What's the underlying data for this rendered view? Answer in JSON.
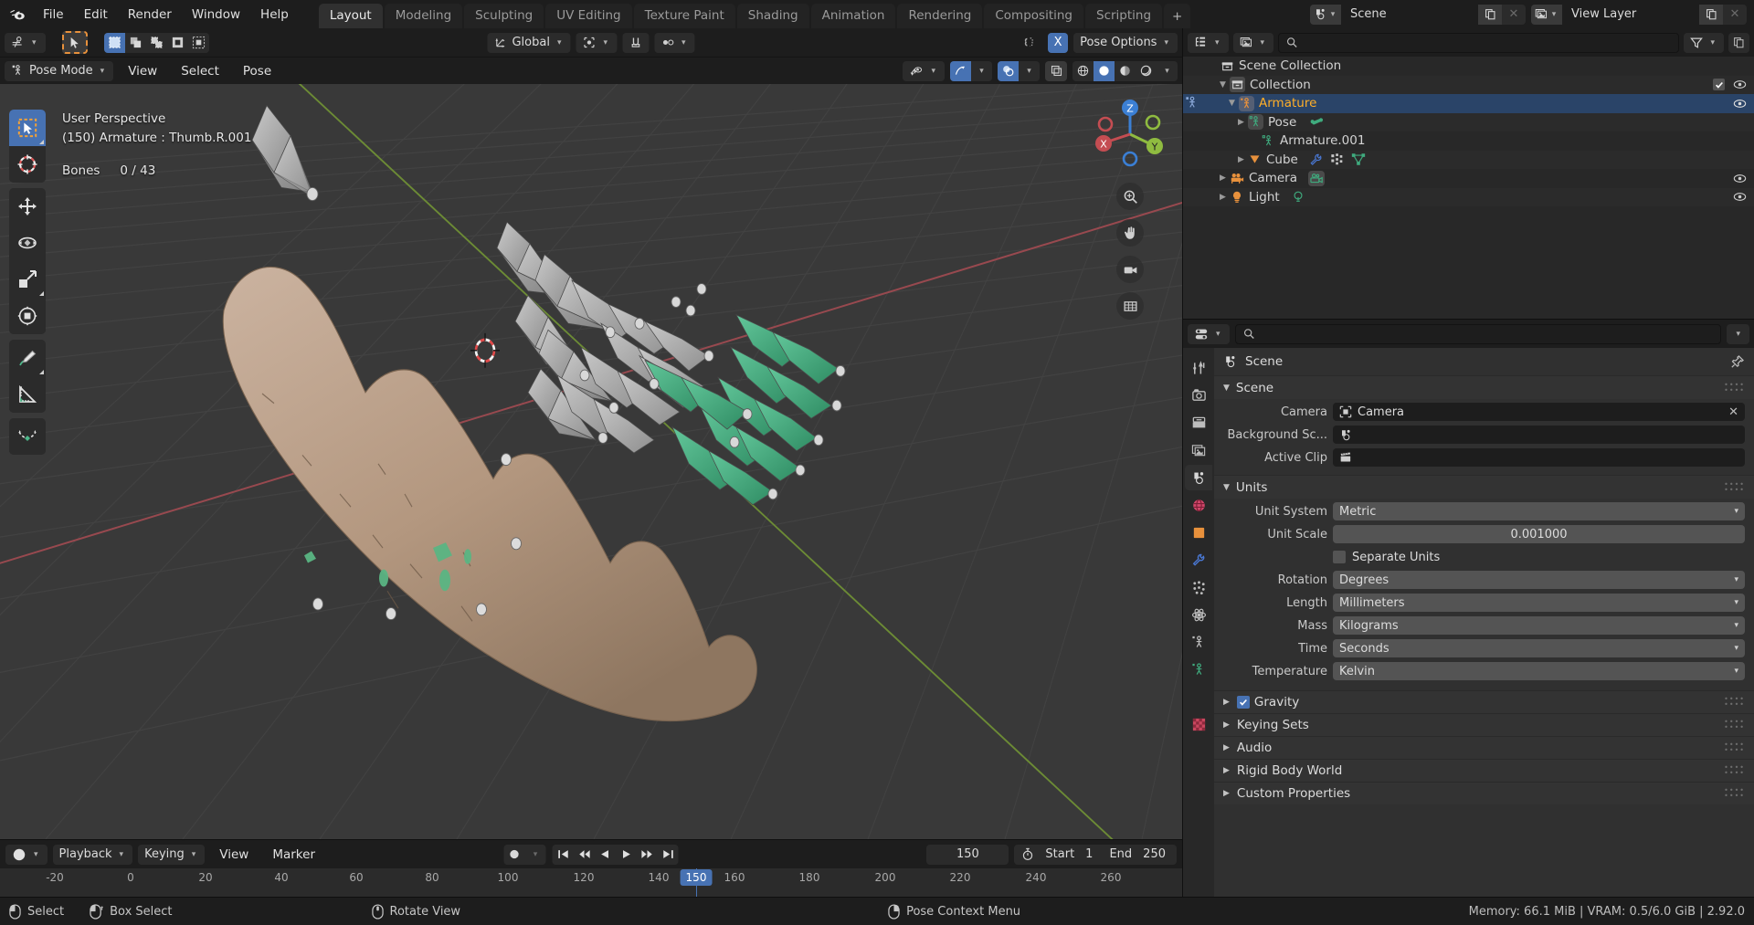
{
  "topbar": {
    "logo_icon": "blender-logo-icon",
    "menus": [
      "File",
      "Edit",
      "Render",
      "Window",
      "Help"
    ],
    "workspace_tabs": [
      {
        "label": "Layout",
        "active": true
      },
      {
        "label": "Modeling",
        "active": false
      },
      {
        "label": "Sculpting",
        "active": false
      },
      {
        "label": "UV Editing",
        "active": false
      },
      {
        "label": "Texture Paint",
        "active": false
      },
      {
        "label": "Shading",
        "active": false
      },
      {
        "label": "Animation",
        "active": false
      },
      {
        "label": "Rendering",
        "active": false
      },
      {
        "label": "Compositing",
        "active": false
      },
      {
        "label": "Scripting",
        "active": false
      }
    ],
    "add_workspace_label": "+",
    "scene_name": "Scene",
    "view_layer_name": "View Layer"
  },
  "viewport": {
    "mode": "Pose Mode",
    "menus": [
      "View",
      "Select",
      "Pose"
    ],
    "transform_orientation": "Global",
    "pose_options": "Pose Options",
    "proportional_x": "X",
    "overlay_text": {
      "perspective": "User Perspective",
      "context": "(150) Armature : Thumb.R.001",
      "bones_label": "Bones",
      "bones_value": "0 / 43"
    },
    "tools": [
      "tweak-select-tool",
      "cursor-tool",
      "move-tool",
      "rotate-tool",
      "scale-tool",
      "transform-tool",
      "annotate-tool",
      "measure-tool",
      "breakdowner-tool"
    ],
    "gizmo_axes": {
      "x": "X",
      "y": "Y",
      "z": "Z"
    },
    "nav_buttons": [
      "zoom-icon",
      "pan-hand-icon",
      "camera-view-icon",
      "toggle-ortho-icon"
    ]
  },
  "timeline": {
    "editor_icon": "timeline-editor-icon",
    "menus": [
      "Playback",
      "Keying",
      "View",
      "Marker"
    ],
    "record_icon": "auto-keying-icon",
    "transport": [
      "jump-start-icon",
      "prev-keyframe-icon",
      "play-reverse-icon",
      "play-icon",
      "next-keyframe-icon",
      "jump-end-icon"
    ],
    "current_frame": "150",
    "start_label": "Start",
    "start_value": "1",
    "end_label": "End",
    "end_value": "250",
    "ruler_ticks": [
      "-20",
      "0",
      "20",
      "40",
      "60",
      "80",
      "100",
      "120",
      "140",
      "160",
      "180",
      "200",
      "220",
      "240",
      "260"
    ],
    "playhead_label": "150"
  },
  "outliner": {
    "display_mode_icon": "outliner-display-mode-icon",
    "filter_icon": "filter-icon",
    "search_placeholder": "",
    "search_value": "",
    "rows": [
      {
        "label": "Scene Collection",
        "depth": 0,
        "icon": "scene-collection-icon",
        "disclosure": "",
        "selected": false,
        "active": false,
        "checkbox": false,
        "eye": false,
        "extras": []
      },
      {
        "label": "Collection",
        "depth": 1,
        "icon": "collection-icon",
        "disclosure": "down",
        "selected": false,
        "active": false,
        "checkbox": true,
        "eye": true,
        "extras": []
      },
      {
        "label": "Armature",
        "depth": 2,
        "icon": "armature-object-icon",
        "disclosure": "down",
        "selected": true,
        "active": true,
        "checkbox": false,
        "eye": true,
        "extras": []
      },
      {
        "label": "Pose",
        "depth": 3,
        "icon": "pose-icon",
        "disclosure": "right",
        "selected": false,
        "active": false,
        "checkbox": false,
        "eye": false,
        "extras": [
          "bone-icon"
        ]
      },
      {
        "label": "Armature.001",
        "depth": 4,
        "icon": "armature-data-icon",
        "disclosure": "",
        "selected": false,
        "active": false,
        "checkbox": false,
        "eye": false,
        "extras": []
      },
      {
        "label": "Cube",
        "depth": 3,
        "icon": "mesh-object-icon",
        "disclosure": "right",
        "selected": false,
        "active": false,
        "checkbox": false,
        "eye": true,
        "extras": [
          "modifier-wrench-icon",
          "vertex-group-icon",
          "mesh-data-icon"
        ]
      },
      {
        "label": "Camera",
        "depth": 2,
        "icon": "camera-object-icon",
        "disclosure": "right",
        "selected": false,
        "active": false,
        "checkbox": false,
        "eye": true,
        "extras": [
          "camera-data-icon"
        ]
      },
      {
        "label": "Light",
        "depth": 2,
        "icon": "light-object-icon",
        "disclosure": "right",
        "selected": false,
        "active": false,
        "checkbox": false,
        "eye": true,
        "extras": [
          "light-data-icon"
        ]
      }
    ]
  },
  "properties": {
    "editor_icon": "properties-editor-icon",
    "search_placeholder": "",
    "search_value": "",
    "breadcrumb": "Scene",
    "pin_icon": "pin-icon",
    "tabs": [
      {
        "name": "tool-tab",
        "active": false
      },
      {
        "name": "render-tab",
        "active": false
      },
      {
        "name": "output-tab",
        "active": false
      },
      {
        "name": "view-layer-tab",
        "active": false
      },
      {
        "name": "scene-tab",
        "active": true
      },
      {
        "name": "world-tab",
        "active": false
      },
      {
        "name": "object-tab",
        "active": false
      },
      {
        "name": "modifier-tab",
        "active": false
      },
      {
        "name": "particles-tab",
        "active": false
      },
      {
        "name": "physics-tab",
        "active": false
      },
      {
        "name": "constraints-tab",
        "active": false
      },
      {
        "name": "data-tab",
        "active": false
      },
      {
        "name": "material-tab",
        "active": false
      }
    ],
    "scene_panel": {
      "title": "Scene",
      "camera_label": "Camera",
      "camera_value": "Camera",
      "background_label": "Background Sc...",
      "background_value": "",
      "active_clip_label": "Active Clip",
      "active_clip_value": ""
    },
    "units_panel": {
      "title": "Units",
      "rows": [
        {
          "label": "Unit System",
          "value": "Metric",
          "type": "dropdown"
        },
        {
          "label": "Unit Scale",
          "value": "0.001000",
          "type": "number"
        },
        {
          "label": "",
          "value": "Separate Units",
          "type": "checkbox",
          "checked": false
        },
        {
          "label": "Rotation",
          "value": "Degrees",
          "type": "dropdown"
        },
        {
          "label": "Length",
          "value": "Millimeters",
          "type": "dropdown"
        },
        {
          "label": "Mass",
          "value": "Kilograms",
          "type": "dropdown"
        },
        {
          "label": "Time",
          "value": "Seconds",
          "type": "dropdown"
        },
        {
          "label": "Temperature",
          "value": "Kelvin",
          "type": "dropdown"
        }
      ]
    },
    "collapsed_panels": [
      {
        "label": "Gravity",
        "checkbox": true,
        "checked": true
      },
      {
        "label": "Keying Sets",
        "checkbox": false,
        "checked": false
      },
      {
        "label": "Audio",
        "checkbox": false,
        "checked": false
      },
      {
        "label": "Rigid Body World",
        "checkbox": false,
        "checked": false
      },
      {
        "label": "Custom Properties",
        "checkbox": false,
        "checked": false
      }
    ]
  },
  "statusbar": {
    "hints": [
      {
        "icon": "mouse-left-icon",
        "label": "Select"
      },
      {
        "icon": "mouse-left-drag-icon",
        "label": "Box Select"
      },
      {
        "icon": "mouse-middle-icon",
        "label": "Rotate View"
      },
      {
        "icon": "mouse-right-icon",
        "label": "Pose Context Menu"
      }
    ],
    "info": "Memory: 66.1 MiB | VRAM: 0.5/6.0 GiB | 2.92.0"
  },
  "colors": {
    "accent_blue": "#4772b3",
    "active_orange": "#ffaf29",
    "bone_green": "#3fab7e",
    "hand_skin": "#b89d89",
    "viewport_bg": "#393939",
    "panel_bg": "#303030",
    "header_bg": "#1d1d1d",
    "axis_x_red": "#c44d52",
    "axis_y_green": "#8fbb40",
    "axis_z_blue": "#3b7fd4"
  }
}
